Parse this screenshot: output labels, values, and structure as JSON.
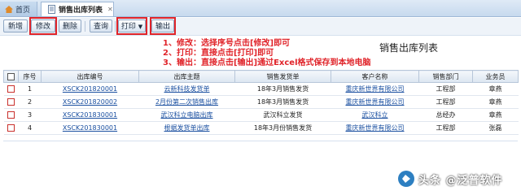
{
  "tabs": [
    {
      "label": "首页"
    },
    {
      "label": "销售出库列表"
    }
  ],
  "toolbar": {
    "add": "新增",
    "edit": "修改",
    "delete": "删除",
    "query": "查询",
    "print": "打印",
    "export": "输出"
  },
  "annotations": [
    "1、修改：选择序号点击[修改]即可",
    "2、打印：直接点击[打印]即可",
    "3、输出：直接点击[输出]通过Excel格式保存到本地电脑"
  ],
  "page_title": "销售出库列表",
  "table": {
    "headers": [
      "序号",
      "出库编号",
      "出库主题",
      "销售发货单",
      "客户名称",
      "销售部门",
      "业务员"
    ],
    "rows": [
      {
        "seq": "1",
        "code": "XSCK201820001",
        "subject": "云新科技发货单",
        "invoice": "18年3月销售发货",
        "customer": "重庆新世界有限公司",
        "dept": "工程部",
        "staff": "章燕"
      },
      {
        "seq": "2",
        "code": "XSCK201820002",
        "subject": "2月份第二次销售出库",
        "invoice": "18年3月销售发货",
        "customer": "重庆新世界有限公司",
        "dept": "工程部",
        "staff": "章燕"
      },
      {
        "seq": "3",
        "code": "XSCK201830001",
        "subject": "武汉科立电脑出库",
        "invoice": "武汉科立发货",
        "customer": "武汉科立",
        "dept": "总经办",
        "staff": "章燕"
      },
      {
        "seq": "4",
        "code": "XSCK201830001",
        "subject": "根据发货单出库",
        "invoice": "18年3月份销售发货",
        "customer": "重庆新世界有限公司",
        "dept": "工程部",
        "staff": "张磊"
      }
    ]
  },
  "watermark": {
    "text": "头条 @泛普软件"
  },
  "colors": {
    "accent": "#e0242a",
    "link": "#1a4fa0",
    "header_bg": "#dce6f1"
  }
}
